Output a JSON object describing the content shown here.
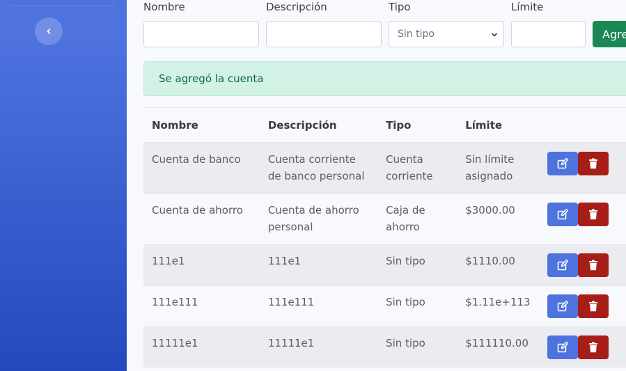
{
  "form": {
    "nombre_label": "Nombre",
    "descripcion_label": "Descripción",
    "tipo_label": "Tipo",
    "limite_label": "Límite",
    "nombre_value": "",
    "descripcion_value": "",
    "tipo_selected": "Sin tipo",
    "limite_value": "",
    "add_button_label": "Agregar"
  },
  "alert": {
    "message": "Se agregó la cuenta"
  },
  "table": {
    "headers": [
      "Nombre",
      "Descripción",
      "Tipo",
      "Límite"
    ],
    "rows": [
      {
        "nombre": "Cuenta de banco",
        "descripcion": "Cuenta corriente de banco personal",
        "tipo": "Cuenta corriente",
        "limite": "Sin límite asignado"
      },
      {
        "nombre": "Cuenta de ahorro",
        "descripcion": "Cuenta de ahorro personal",
        "tipo": "Caja de ahorro",
        "limite": "$3000.00"
      },
      {
        "nombre": "111e1",
        "descripcion": "111e1",
        "tipo": "Sin tipo",
        "limite": "$1110.00"
      },
      {
        "nombre": "111e111",
        "descripcion": "111e111",
        "tipo": "Sin tipo",
        "limite": "$1.11e+113"
      },
      {
        "nombre": "11111e1",
        "descripcion": "11111e1",
        "tipo": "Sin tipo",
        "limite": "$111110.00"
      }
    ]
  },
  "icons": {
    "sidebar_toggle": "chevron-left-icon",
    "edit": "edit-icon",
    "delete": "trash-icon"
  },
  "colors": {
    "sidebar_top": "#4e73df",
    "sidebar_bottom": "#224abe",
    "add_button": "#1a8754",
    "edit_button": "#4e73df",
    "delete_button": "#a71d17",
    "alert_bg": "#d1f2e4",
    "alert_text": "#0f6848"
  }
}
